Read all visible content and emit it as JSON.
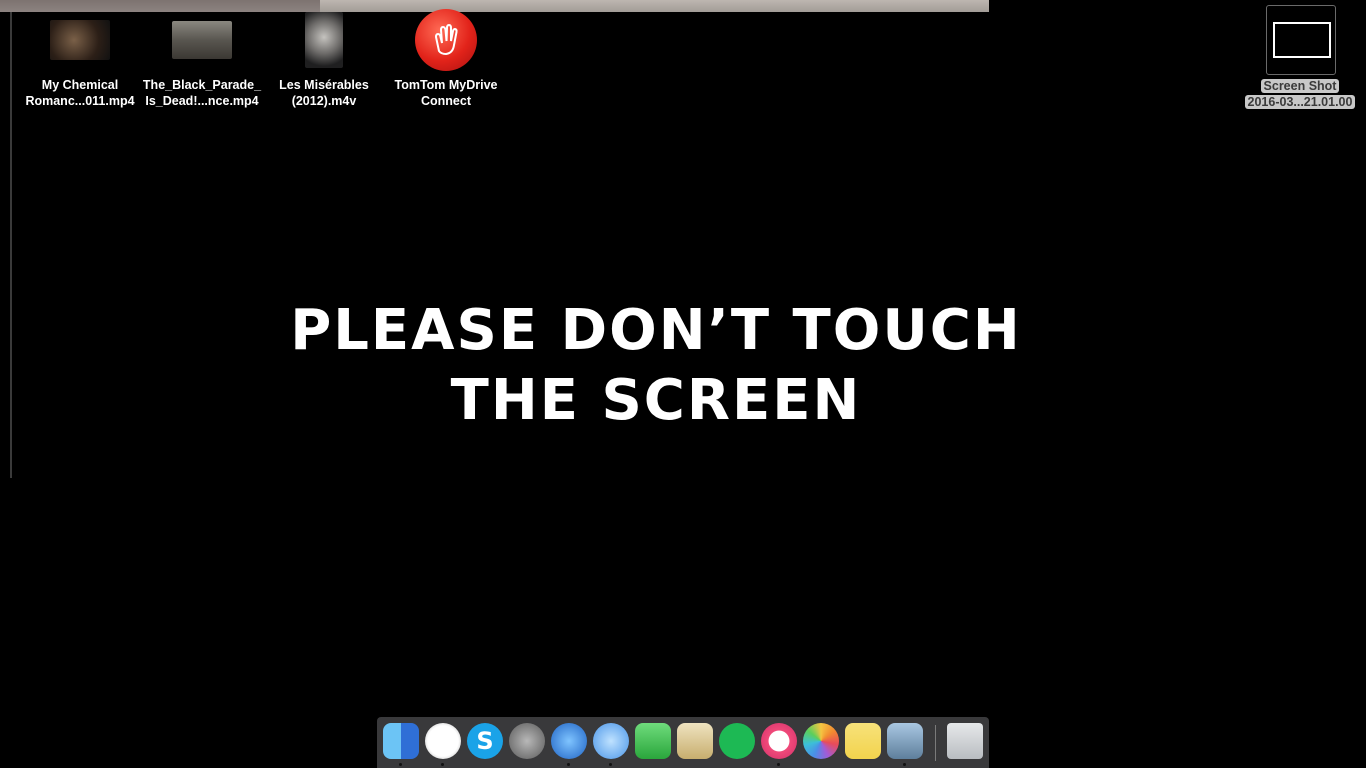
{
  "desktop": {
    "icons": [
      {
        "label": "My Chemical\nRomanc...011.mp4"
      },
      {
        "label": "The_Black_Parade_\nIs_Dead!...nce.mp4"
      },
      {
        "label": "Les Misérables\n(2012).m4v"
      },
      {
        "label": "TomTom MyDrive\nConnect"
      }
    ],
    "screenshot_icon": {
      "label_line1": "Screen Shot",
      "label_line2": "2016-03...21.01.00"
    }
  },
  "message": "PLEASE DON’T TOUCH\nTHE SCREEN",
  "dock": {
    "apps": [
      {
        "name": "finder-icon",
        "color": "#3a8fe8"
      },
      {
        "name": "clock-icon",
        "color": "#f2f2f2"
      },
      {
        "name": "skype-icon",
        "color": "#1aa3e8"
      },
      {
        "name": "launchpad-icon",
        "color": "#8a8a8a"
      },
      {
        "name": "safari-icon",
        "color": "#2f7bd8"
      },
      {
        "name": "messages-icon",
        "color": "#5aa7f2"
      },
      {
        "name": "facetime-icon",
        "color": "#3fbf52"
      },
      {
        "name": "preview-icon",
        "color": "#d9c79a"
      },
      {
        "name": "spotify-icon",
        "color": "#1db954"
      },
      {
        "name": "itunes-icon",
        "color": "#e8467c"
      },
      {
        "name": "photos-icon",
        "color": "#f4c542"
      },
      {
        "name": "notes-icon",
        "color": "#f7e27a"
      },
      {
        "name": "image-capture-icon",
        "color": "#7fa7c9"
      },
      {
        "name": "trash-icon",
        "color": "#cfd2d6"
      }
    ]
  }
}
